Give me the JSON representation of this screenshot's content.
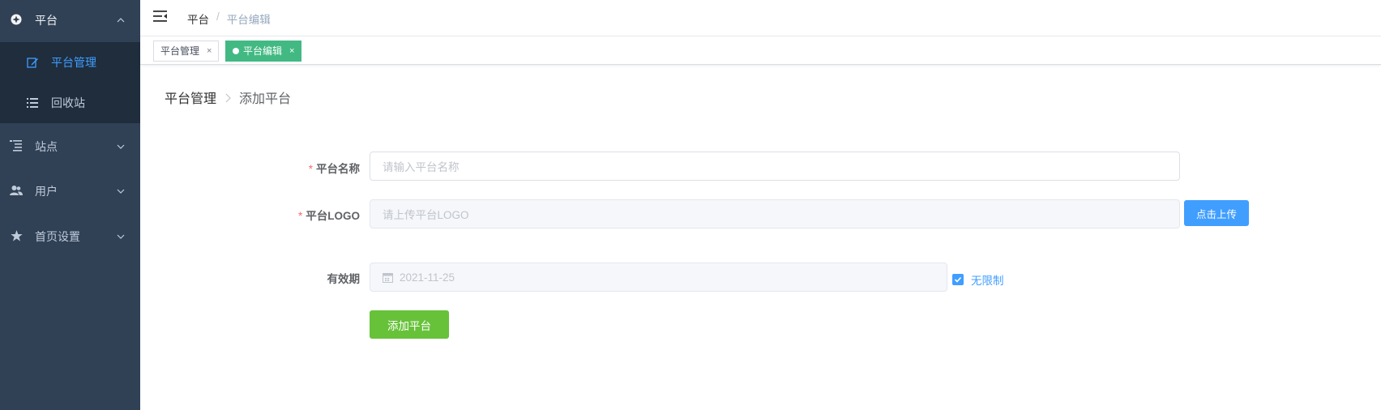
{
  "sidebar": {
    "groups": [
      {
        "label": "平台",
        "icon": "compass-icon",
        "expanded": true
      },
      {
        "label": "站点",
        "icon": "list-tree-icon",
        "expanded": false
      },
      {
        "label": "用户",
        "icon": "users-icon",
        "expanded": false
      },
      {
        "label": "首页设置",
        "icon": "star-icon",
        "expanded": false
      }
    ],
    "platform_items": [
      {
        "label": "平台管理",
        "icon": "edit-icon",
        "selected": true
      },
      {
        "label": "回收站",
        "icon": "list-icon",
        "selected": false
      }
    ]
  },
  "navbar": {
    "breadcrumb": [
      "平台",
      "平台编辑"
    ],
    "separator": "/"
  },
  "tags": [
    {
      "label": "平台管理",
      "active": false,
      "close": "×"
    },
    {
      "label": "平台编辑",
      "active": true,
      "close": "×"
    }
  ],
  "page_breadcrumb": [
    "平台管理",
    "添加平台"
  ],
  "form": {
    "required_mark": "*",
    "name_label": "平台名称",
    "name_placeholder": "请输入平台名称",
    "logo_label": "平台LOGO",
    "logo_placeholder": "请上传平台LOGO",
    "upload_button": "点击上传",
    "validity_label": "有效期",
    "validity_value": "2021-11-25",
    "unlimited_label": "无限制",
    "unlimited_checked": true,
    "submit_button": "添加平台"
  },
  "colors": {
    "sidebar_bg": "#304156",
    "submenu_bg": "#1f2d3d",
    "accent_blue": "#409eff",
    "tag_active": "#42b983",
    "submit_green": "#67c23a",
    "required_red": "#f56c6c"
  }
}
